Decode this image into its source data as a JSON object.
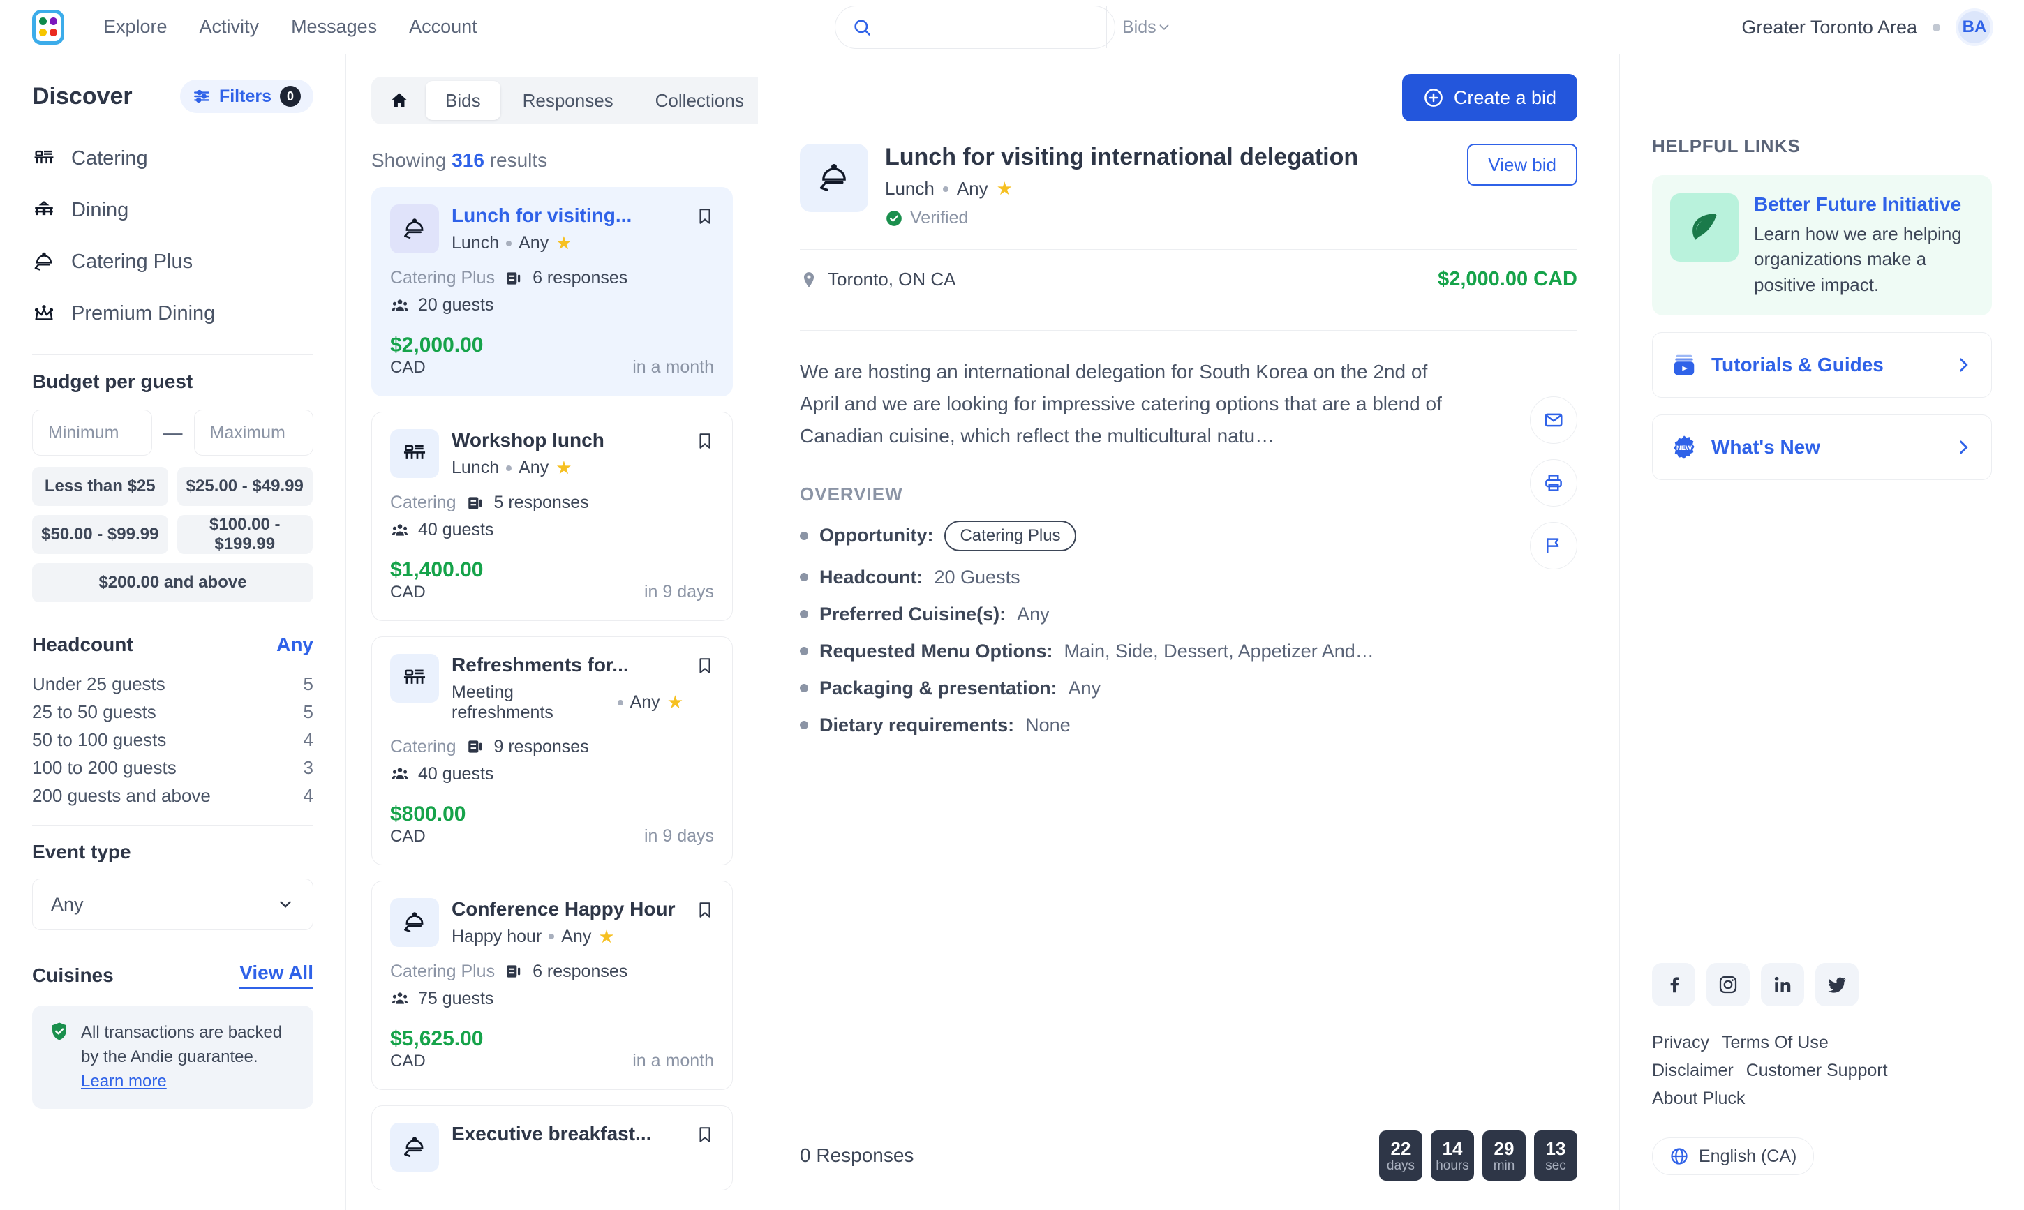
{
  "topnav": {
    "logo_name": "pluck-logo",
    "logo_dots": [
      "#0f8a4a",
      "#7b18bd",
      "#f7c600",
      "#ea2a1f"
    ],
    "links": [
      "Explore",
      "Activity",
      "Messages",
      "Account"
    ],
    "search": {
      "value": "",
      "placeholder": "",
      "scope": "Bids"
    },
    "region": "Greater Toronto Area",
    "avatar_initials": "BA"
  },
  "sidebar": {
    "title": "Discover",
    "filters_label": "Filters",
    "filters_count": "0",
    "categories": [
      {
        "label": "Catering",
        "icon": "catering-table-icon"
      },
      {
        "label": "Dining",
        "icon": "dining-table-icon"
      },
      {
        "label": "Catering Plus",
        "icon": "cloche-hand-icon"
      },
      {
        "label": "Premium Dining",
        "icon": "crown-icon"
      }
    ],
    "budget": {
      "title": "Budget per guest",
      "min_placeholder": "Minimum",
      "min_value": "",
      "max_placeholder": "Maximum",
      "max_value": "",
      "separator": "—",
      "chips": [
        "Less than $25",
        "$25.00 - $49.99",
        "$50.00 - $99.99",
        "$100.00 - $199.99",
        "$200.00 and above"
      ]
    },
    "headcount": {
      "title": "Headcount",
      "any_label": "Any",
      "rows": [
        {
          "label": "Under 25 guests",
          "count": "5"
        },
        {
          "label": "25 to 50 guests",
          "count": "5"
        },
        {
          "label": "50 to 100 guests",
          "count": "4"
        },
        {
          "label": "100 to 200 guests",
          "count": "3"
        },
        {
          "label": "200 guests and above",
          "count": "4"
        }
      ]
    },
    "event_type": {
      "title": "Event type",
      "value": "Any"
    },
    "cuisines": {
      "title": "Cuisines",
      "view_all": "View All"
    },
    "guarantee": {
      "text": "All transactions are backed by the Andie guarantee. ",
      "link": "Learn more"
    }
  },
  "list": {
    "tabs": [
      {
        "label": "",
        "icon": "home-icon",
        "active": false
      },
      {
        "label": "Bids",
        "active": true
      },
      {
        "label": "Responses",
        "active": false
      },
      {
        "label": "Collections",
        "active": false
      }
    ],
    "showing_prefix": "Showing ",
    "showing_count": "316",
    "showing_suffix": " results",
    "cards": [
      {
        "title": "Lunch for visiting...",
        "meal": "Lunch",
        "cuisine": "Any",
        "service": "Catering Plus",
        "responses": "6 responses",
        "guests": "20 guests",
        "price": "$2,000.00",
        "currency": "CAD",
        "when": "in a month",
        "icon": "cloche-hand-icon",
        "selected": true
      },
      {
        "title": "Workshop lunch",
        "meal": "Lunch",
        "cuisine": "Any",
        "service": "Catering",
        "responses": "5 responses",
        "guests": "40 guests",
        "price": "$1,400.00",
        "currency": "CAD",
        "when": "in 9 days",
        "icon": "catering-table-icon",
        "selected": false
      },
      {
        "title": "Refreshments for...",
        "meal": "Meeting refreshments",
        "cuisine": "Any",
        "service": "Catering",
        "responses": "9 responses",
        "guests": "40 guests",
        "price": "$800.00",
        "currency": "CAD",
        "when": "in 9 days",
        "icon": "catering-table-icon",
        "selected": false
      },
      {
        "title": "Conference Happy Hour",
        "meal": "Happy hour",
        "cuisine": "Any",
        "service": "Catering Plus",
        "responses": "6 responses",
        "guests": "75 guests",
        "price": "$5,625.00",
        "currency": "CAD",
        "when": "in a month",
        "icon": "cloche-hand-icon",
        "selected": false
      },
      {
        "title": "Executive breakfast...",
        "meal": "",
        "cuisine": "",
        "service": "",
        "responses": "",
        "guests": "",
        "price": "",
        "currency": "",
        "when": "",
        "icon": "cloche-hand-icon",
        "selected": false
      }
    ]
  },
  "detail": {
    "create_bid_label": "Create a bid",
    "title": "Lunch for visiting international delegation",
    "meal": "Lunch",
    "cuisine": "Any",
    "verified_label": "Verified",
    "view_bid_label": "View bid",
    "location": "Toronto, ON CA",
    "price": "$2,000.00 CAD",
    "description": "We are hosting an international delegation for South Korea on the 2nd of April and we are looking for impressive catering options that are a blend of Canadian cuisine, which reflect the multicultural natu…",
    "overview_title": "OVERVIEW",
    "overview": [
      {
        "key": "Opportunity:",
        "value": "Catering Plus",
        "pill": true
      },
      {
        "key": "Headcount:",
        "value": "20 Guests",
        "pill": false
      },
      {
        "key": "Preferred Cuisine(s):",
        "value": "Any",
        "pill": false
      },
      {
        "key": "Requested Menu Options:",
        "value": "Main, Side, Dessert, Appetizer And…",
        "pill": false
      },
      {
        "key": "Packaging & presentation:",
        "value": "Any",
        "pill": false
      },
      {
        "key": "Dietary requirements:",
        "value": "None",
        "pill": false
      }
    ],
    "actions": [
      {
        "icon": "email-icon"
      },
      {
        "icon": "print-icon"
      },
      {
        "icon": "flag-icon"
      }
    ],
    "responses_label": "0 Responses",
    "countdown": [
      {
        "num": "22",
        "unit": "days"
      },
      {
        "num": "14",
        "unit": "hours"
      },
      {
        "num": "29",
        "unit": "min"
      },
      {
        "num": "13",
        "unit": "sec"
      }
    ]
  },
  "rightpanel": {
    "title": "HELPFUL LINKS",
    "promo": {
      "title": "Better Future Initiative",
      "body": "Learn how we are helping organizations make a positive impact.",
      "icon": "leaf-icon"
    },
    "links": [
      {
        "label": "Tutorials & Guides",
        "icon": "video-library-icon"
      },
      {
        "label": "What's New",
        "icon": "new-badge-icon"
      }
    ],
    "socials": [
      "facebook-icon",
      "instagram-icon",
      "linkedin-icon",
      "twitter-icon"
    ],
    "legal": [
      "Privacy",
      "Terms Of Use",
      "Disclaimer",
      "Customer Support",
      "About Pluck"
    ],
    "language": "English (CA)"
  },
  "colors": {
    "accent": "#2f62e8",
    "primary_button": "#2356dc",
    "money_green": "#16a34a",
    "dark": "#2e3647",
    "muted": "#8b94a5"
  }
}
